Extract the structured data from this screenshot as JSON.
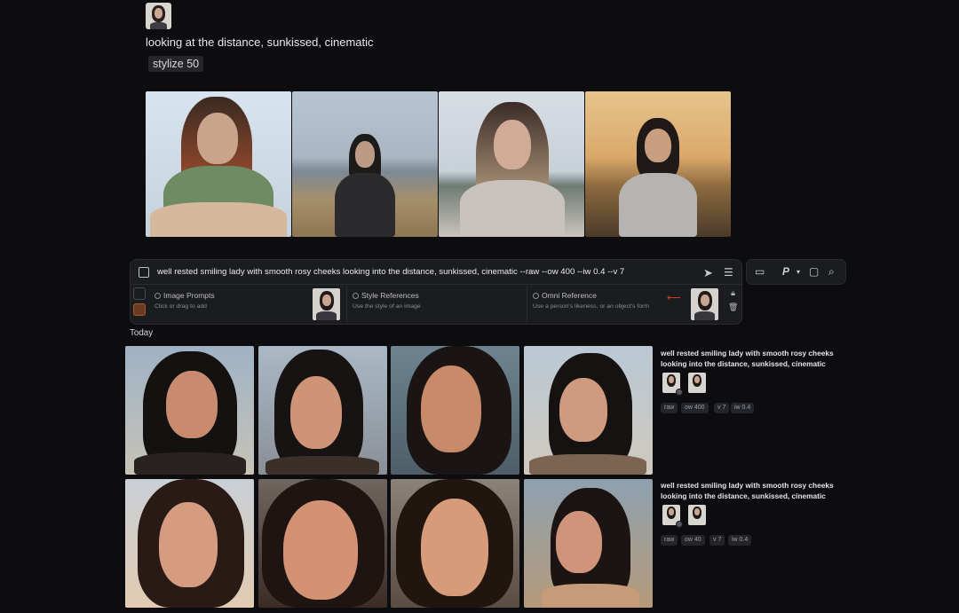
{
  "top": {
    "prompt": "looking at the distance, sunkissed, cinematic",
    "stylize_chip": "stylize 50"
  },
  "composer": {
    "prompt": "well rested smiling lady with smooth rosy cheeks looking into the distance, sunkissed, cinematic --raw --ow 400 --iw 0.4 --v 7",
    "image_prompts": {
      "title": "Image Prompts",
      "subtitle": "Click or drag to add"
    },
    "style_references": {
      "title": "Style References",
      "subtitle": "Use the style of an image"
    },
    "omni_reference": {
      "title": "Omni Reference",
      "subtitle": "Use a person's likeness, or an object's form"
    },
    "icons": [
      "edit-prompt-icon",
      "send-icon",
      "settings-sliders-icon",
      "lock-icon",
      "trash-icon",
      "folder-icon",
      "personalize-p-icon",
      "chevron-down-icon",
      "chat-icon",
      "search-icon"
    ],
    "toolbar_p_label": "P"
  },
  "section_label": "Today",
  "jobs": [
    {
      "prompt": "well rested smiling lady with smooth rosy cheeks looking into the distance, sunkissed, cinematic",
      "chips": [
        "raw",
        "ow 400",
        "v 7",
        "iw 0.4"
      ]
    },
    {
      "prompt": "well rested smiling lady with smooth rosy cheeks looking into the distance, sunkissed, cinematic",
      "chips": [
        "raw",
        "ow 40",
        "v 7",
        "iw 0.4"
      ]
    }
  ],
  "colors": {
    "background": "#0d0d0f",
    "panel": "#1b1c20",
    "accent_red": "#d1452e",
    "accent_orange": "#a25a30"
  }
}
